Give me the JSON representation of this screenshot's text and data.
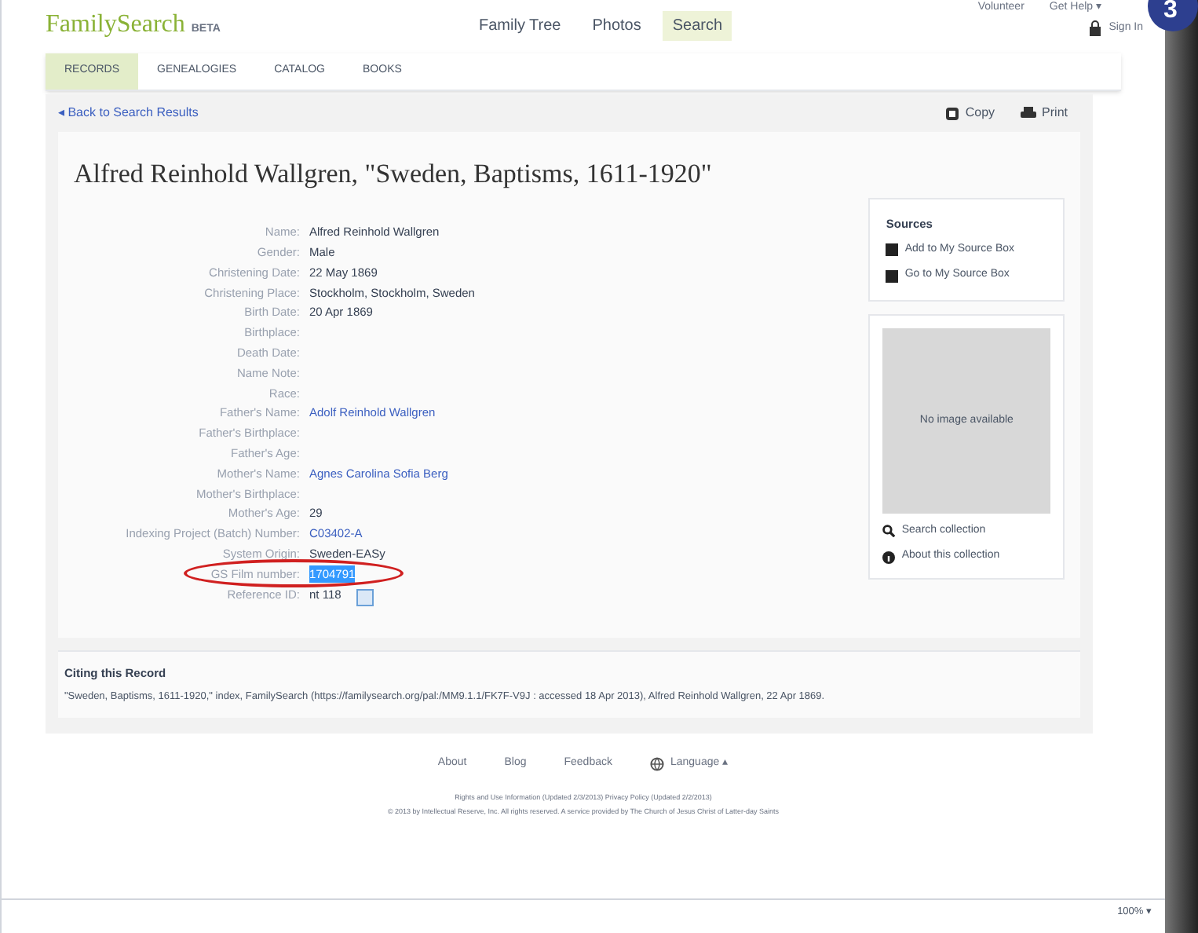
{
  "badge": "3",
  "header": {
    "logo": "FamilySearch",
    "logo_tag": "BETA",
    "nav": [
      {
        "label": "Family Tree",
        "selected": false
      },
      {
        "label": "Photos",
        "selected": false
      },
      {
        "label": "Search",
        "selected": true
      }
    ],
    "top_links": [
      "Volunteer",
      "Get Help ▾"
    ],
    "sign_in": "Sign In"
  },
  "tabs": [
    {
      "label": "RECORDS",
      "selected": true
    },
    {
      "label": "GENEALOGIES",
      "selected": false
    },
    {
      "label": "CATALOG",
      "selected": false
    },
    {
      "label": "BOOKS",
      "selected": false
    }
  ],
  "back_link": "◂ Back to Search Results",
  "actions": [
    "Copy",
    "Print"
  ],
  "title": "Alfred Reinhold Wallgren, \"Sweden, Baptisms, 1611-1920\"",
  "fields": [
    {
      "label": "Name:",
      "value": "Alfred Reinhold Wallgren",
      "link": false,
      "highlighted": false
    },
    {
      "label": "Gender:",
      "value": "Male",
      "link": false,
      "highlighted": false
    },
    {
      "label": "Christening Date:",
      "value": "22 May 1869",
      "link": false,
      "highlighted": false
    },
    {
      "label": "Christening Place:",
      "value": "Stockholm, Stockholm, Sweden",
      "link": false,
      "highlighted": false
    },
    {
      "label": "Birth Date:",
      "value": "20 Apr 1869",
      "link": false,
      "highlighted": false
    },
    {
      "label": "Birthplace:"
    },
    {
      "label": "Death Date:"
    },
    {
      "label": "Name Note:"
    },
    {
      "label": "Race:"
    },
    {
      "label": "Father's Name:",
      "value": "Adolf Reinhold Wallgren",
      "link": true,
      "highlighted": false
    },
    {
      "label": "Father's Birthplace:"
    },
    {
      "label": "Father's Age:"
    },
    {
      "label": "Mother's Name:",
      "value": "Agnes Carolina Sofia Berg",
      "link": true,
      "highlighted": false
    },
    {
      "label": "Mother's Birthplace:"
    },
    {
      "label": "Mother's Age:",
      "value": "29",
      "link": false,
      "highlighted": false
    },
    {
      "label": "Indexing Project (Batch) Number:",
      "value": "C03402-A",
      "link": true,
      "highlighted": false
    },
    {
      "label": "System Origin:",
      "value": "Sweden-EASy",
      "link": false,
      "highlighted": false
    },
    {
      "label": "GS Film number:",
      "value": "1704791",
      "link": false,
      "highlighted": true
    },
    {
      "label": "Reference ID:",
      "value": "nt 118",
      "link": false,
      "highlighted": false
    }
  ],
  "sources": {
    "heading": "Sources",
    "items": [
      "Add to My Source Box",
      "Go to My Source Box"
    ]
  },
  "image_placeholder": "No image available",
  "collection_links": [
    "Search collection",
    "About this collection"
  ],
  "citation": {
    "heading": "Citing this Record",
    "text": "\"Sweden, Baptisms, 1611-1920,\" index, FamilySearch (https://familysearch.org/pal:/MM9.1.1/FK7F-V9J : accessed 18 Apr 2013), Alfred Reinhold Wallgren, 22 Apr 1869."
  },
  "footer": {
    "links": [
      "About",
      "Blog",
      "Feedback",
      "Language ▴"
    ],
    "legal": "Rights and Use Information (Updated 2/3/2013) Privacy Policy (Updated 2/2/2013)",
    "copyright": "© 2013 by Intellectual Reserve, Inc. All rights reserved. A service provided by The Church of Jesus Christ of Latter-day Saints"
  },
  "status_bar": {
    "zoom": "100% ▾"
  }
}
